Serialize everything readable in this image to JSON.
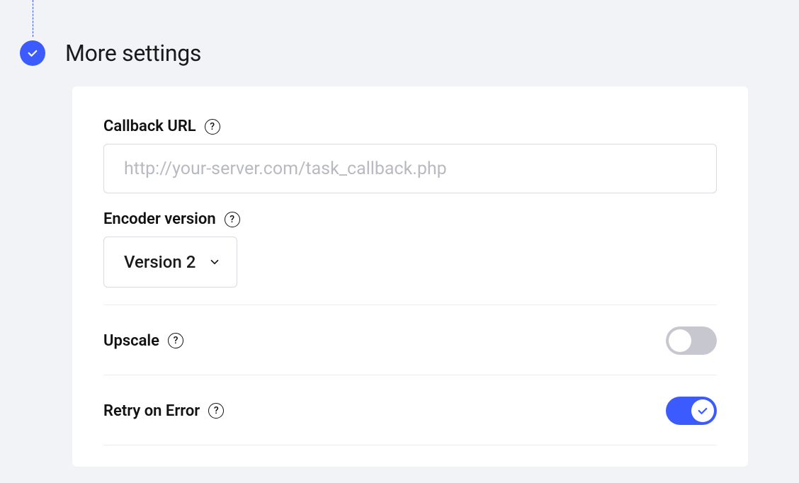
{
  "section": {
    "title": "More settings"
  },
  "form": {
    "callback": {
      "label": "Callback URL",
      "placeholder": "http://your-server.com/task_callback.php",
      "value": ""
    },
    "encoder": {
      "label": "Encoder version",
      "selected": "Version 2"
    },
    "upscale": {
      "label": "Upscale",
      "enabled": false
    },
    "retry": {
      "label": "Retry on Error",
      "enabled": true
    }
  },
  "colors": {
    "accent": "#3b5bff"
  }
}
